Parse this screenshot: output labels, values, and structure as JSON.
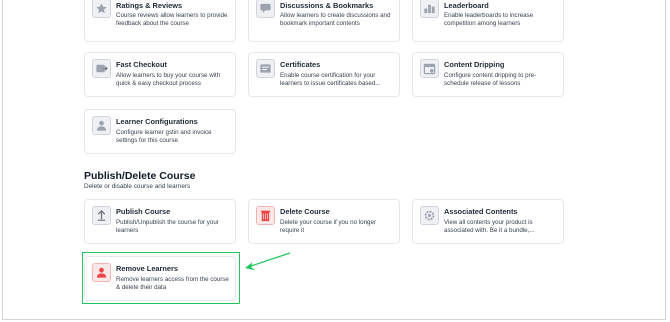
{
  "row1": [
    {
      "title": "Ratings & Reviews",
      "desc": "Course reviews allow learners to provide feedback about the course",
      "icon": "star-icon"
    },
    {
      "title": "Discussions & Bookmarks",
      "desc": "Allow learners to create discussions and bookmark important contents",
      "icon": "discussion-icon"
    },
    {
      "title": "Leaderboard",
      "desc": "Enable leaderboards to increase competition among learners",
      "icon": "leaderboard-icon"
    }
  ],
  "row2": [
    {
      "title": "Fast Checkout",
      "desc": "Allow learners to buy your course with quick & easy checkout process",
      "icon": "checkout-icon"
    },
    {
      "title": "Certificates",
      "desc": "Enable course certification for your learners to issue certificates based...",
      "icon": "certificate-icon"
    },
    {
      "title": "Content Dripping",
      "desc": "Configure content dripping to pre-schedule release of lessons",
      "icon": "calendar-icon"
    }
  ],
  "row3": [
    {
      "title": "Learner Configurations",
      "desc": "Configure learner gstin and invoice settings for this course",
      "icon": "learner-icon"
    }
  ],
  "section": {
    "title": "Publish/Delete Course",
    "subtitle": "Delete or disable course and learners"
  },
  "row4": [
    {
      "title": "Publish Course",
      "desc": "Publish/Unpublish the course for your learners",
      "icon": "upload-icon"
    },
    {
      "title": "Delete Course",
      "desc": "Delete your course if you no longer require it",
      "icon": "trash-icon"
    },
    {
      "title": "Associated Contents",
      "desc": "View all contents your product is associated with. Be it a bundle,...",
      "icon": "gear-icon"
    }
  ],
  "row5": [
    {
      "title": "Remove Learners",
      "desc": "Remove learners access from the course & delete their data",
      "icon": "remove-user-icon"
    }
  ],
  "colors": {
    "highlight": "#22c55e",
    "delete": "#ef4444"
  }
}
